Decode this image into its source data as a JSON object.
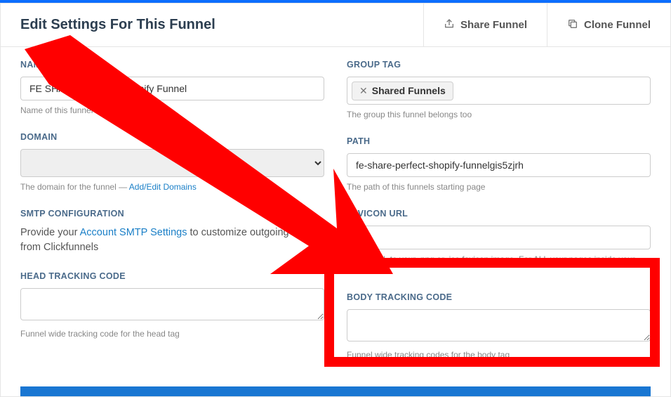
{
  "header": {
    "title": "Edit Settings For This Funnel",
    "share_label": "Share Funnel",
    "clone_label": "Clone Funnel"
  },
  "left": {
    "name": {
      "label": "NAME",
      "value": "FE SHARE - Perfect Shopify Funnel",
      "help": "Name of this funnel"
    },
    "domain": {
      "label": "DOMAIN",
      "help_prefix": "The domain for the funnel — ",
      "help_link": "Add/Edit Domains"
    },
    "smtp": {
      "label": "SMTP CONFIGURATION",
      "text_a": "Provide your ",
      "text_link": "Account SMTP Settings",
      "text_b": " to customize outgoing emails from Clickfunnels"
    },
    "head": {
      "label": "HEAD TRACKING CODE",
      "help": "Funnel wide tracking code for the head tag"
    }
  },
  "right": {
    "group": {
      "label": "GROUP TAG",
      "tag": "Shared Funnels",
      "help": "The group this funnel belongs too"
    },
    "path": {
      "label": "PATH",
      "value": "fe-share-perfect-shopify-funnelgis5zjrh",
      "help": "The path of this funnels starting page"
    },
    "favicon": {
      "label": "FAVICON URL",
      "help": "Add a URL to your .png or .ico favicon image. For ALL your pages inside your funnel."
    },
    "body": {
      "label": "BODY TRACKING CODE",
      "help": "Funnel wide tracking codes for the body tag"
    }
  }
}
